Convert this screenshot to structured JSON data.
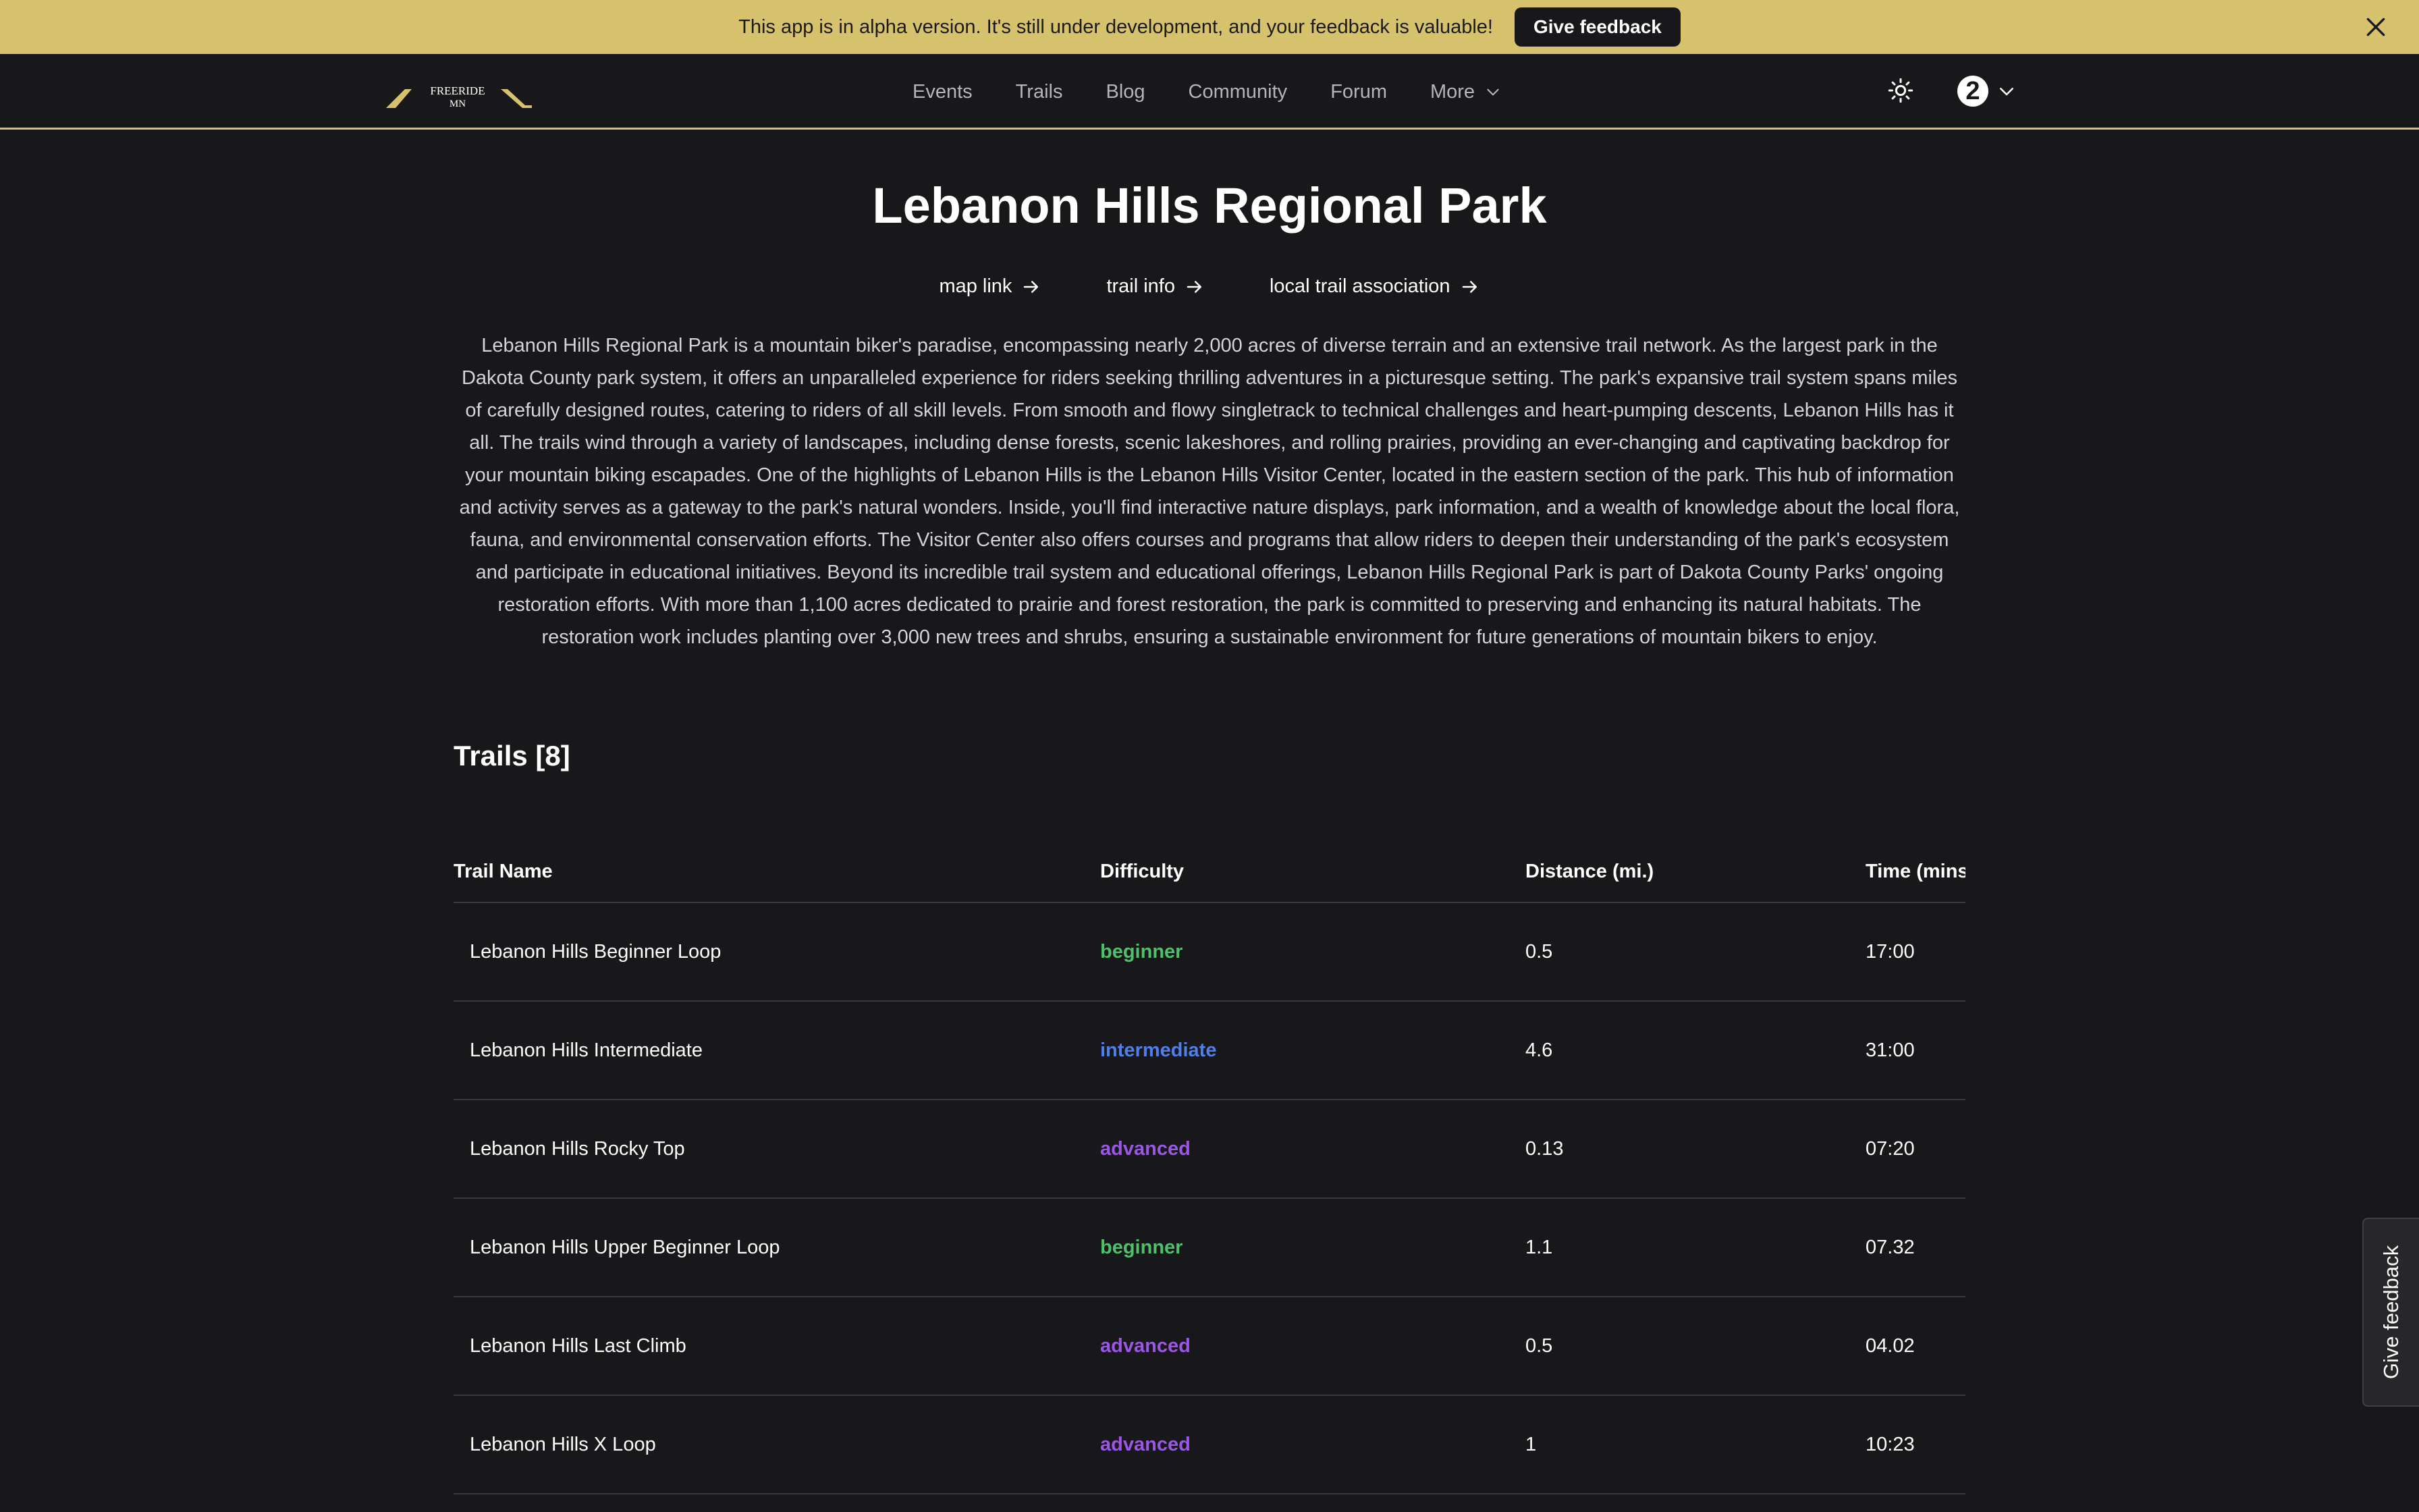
{
  "banner": {
    "text": "This app is in alpha version. It's still under development, and your feedback is valuable!",
    "button_label": "Give feedback"
  },
  "header": {
    "logo_text_top": "FREERIDE",
    "logo_text_bottom": "MN",
    "nav": [
      "Events",
      "Trails",
      "Blog",
      "Community",
      "Forum",
      "More"
    ],
    "user_badge": "2"
  },
  "park": {
    "title": "Lebanon Hills Regional Park",
    "links": [
      "map link",
      "trail info",
      "local trail association"
    ],
    "description": "Lebanon Hills Regional Park is a mountain biker's paradise, encompassing nearly 2,000 acres of diverse terrain and an extensive trail network. As the largest park in the Dakota County park system, it offers an unparalleled experience for riders seeking thrilling adventures in a picturesque setting. The park's expansive trail system spans miles of carefully designed routes, catering to riders of all skill levels. From smooth and flowy singletrack to technical challenges and heart-pumping descents, Lebanon Hills has it all. The trails wind through a variety of landscapes, including dense forests, scenic lakeshores, and rolling prairies, providing an ever-changing and captivating backdrop for your mountain biking escapades. One of the highlights of Lebanon Hills is the Lebanon Hills Visitor Center, located in the eastern section of the park. This hub of information and activity serves as a gateway to the park's natural wonders. Inside, you'll find interactive nature displays, park information, and a wealth of knowledge about the local flora, fauna, and environmental conservation efforts. The Visitor Center also offers courses and programs that allow riders to deepen their understanding of the park's ecosystem and participate in educational initiatives. Beyond its incredible trail system and educational offerings, Lebanon Hills Regional Park is part of Dakota County Parks' ongoing restoration efforts. With more than 1,100 acres dedicated to prairie and forest restoration, the park is committed to preserving and enhancing its natural habitats. The restoration work includes planting over 3,000 new trees and shrubs, ensuring a sustainable environment for future generations of mountain bikers to enjoy."
  },
  "trails": {
    "heading": "Trails [8]",
    "columns": [
      "Trail Name",
      "Difficulty",
      "Distance (mi.)",
      "Time (mins"
    ],
    "rows": [
      {
        "name": "Lebanon Hills Beginner Loop",
        "difficulty": "beginner",
        "distance": "0.5",
        "time": "17:00"
      },
      {
        "name": "Lebanon Hills Intermediate",
        "difficulty": "intermediate",
        "distance": "4.6",
        "time": "31:00"
      },
      {
        "name": "Lebanon Hills Rocky Top",
        "difficulty": "advanced",
        "distance": "0.13",
        "time": "07:20"
      },
      {
        "name": "Lebanon Hills Upper Beginner Loop",
        "difficulty": "beginner",
        "distance": "1.1",
        "time": "07.32"
      },
      {
        "name": "Lebanon Hills Last Climb",
        "difficulty": "advanced",
        "distance": "0.5",
        "time": "04.02"
      },
      {
        "name": "Lebanon Hills X Loop",
        "difficulty": "advanced",
        "distance": "1",
        "time": "10:23"
      }
    ]
  },
  "side_feedback_label": "Give feedback",
  "colors": {
    "accent": "#d6c16d",
    "background": "#18181b",
    "beginner": "#4ec06a",
    "intermediate": "#4f7fe8",
    "advanced": "#9a57e6"
  }
}
